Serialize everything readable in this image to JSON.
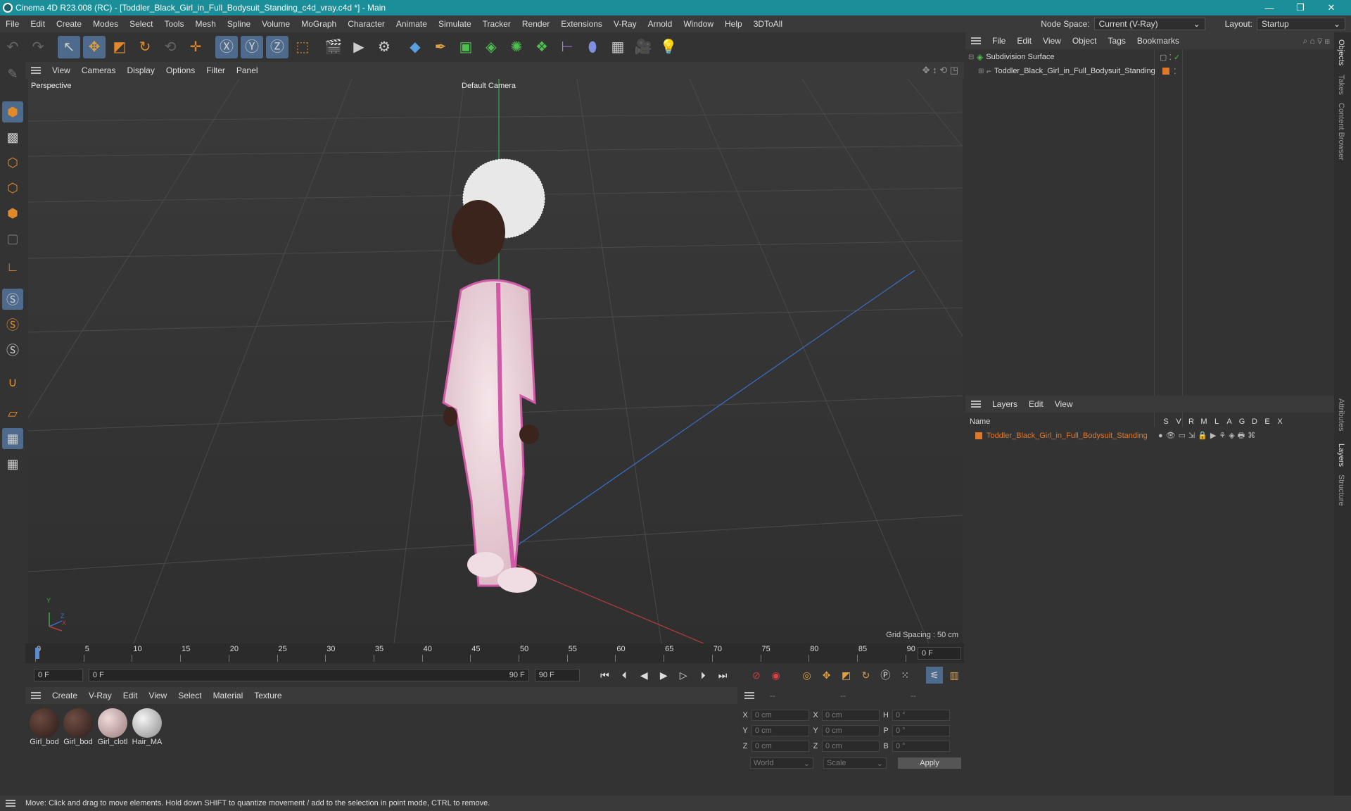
{
  "window": {
    "title": "Cinema 4D R23.008 (RC) - [Toddler_Black_Girl_in_Full_Bodysuit_Standing_c4d_vray.c4d *] - Main",
    "minimize": "—",
    "restore": "❐",
    "close": "✕"
  },
  "menubar": {
    "items": [
      "File",
      "Edit",
      "Create",
      "Modes",
      "Select",
      "Tools",
      "Mesh",
      "Spline",
      "Volume",
      "MoGraph",
      "Character",
      "Animate",
      "Simulate",
      "Tracker",
      "Render",
      "Extensions",
      "V-Ray",
      "Arnold",
      "Window",
      "Help",
      "3DToAll"
    ],
    "node_space_label": "Node Space:",
    "node_space_value": "Current (V-Ray)",
    "layout_label": "Layout:",
    "layout_value": "Startup"
  },
  "viewport": {
    "menu": [
      "View",
      "Cameras",
      "Display",
      "Options",
      "Filter",
      "Panel"
    ],
    "view_name": "Perspective",
    "camera": "Default Camera",
    "grid_spacing": "Grid Spacing : 50 cm",
    "axis_y": "Y",
    "axis_z": "Z",
    "axis_x": "X"
  },
  "timeline": {
    "ticks": [
      "0",
      "5",
      "10",
      "15",
      "20",
      "25",
      "30",
      "35",
      "40",
      "45",
      "50",
      "55",
      "60",
      "65",
      "70",
      "75",
      "80",
      "85",
      "90"
    ],
    "current_frame_right": "0 F",
    "start_field": "0 F",
    "range_start": "0 F",
    "range_end": "90 F",
    "end_field": "90 F"
  },
  "materials": {
    "menu": [
      "Create",
      "V-Ray",
      "Edit",
      "View",
      "Select",
      "Material",
      "Texture"
    ],
    "items": [
      {
        "label": "Girl_bod",
        "color": "#3a2622"
      },
      {
        "label": "Girl_bod",
        "color": "#3d2a26"
      },
      {
        "label": "Girl_clotl",
        "color": "#c9a9a9"
      },
      {
        "label": "Hair_MA",
        "color": "#cfcfcf"
      }
    ]
  },
  "coords": {
    "header": [
      "--",
      "--",
      "--"
    ],
    "rows": [
      {
        "a": "X",
        "av": "0 cm",
        "b": "X",
        "bv": "0 cm",
        "c": "H",
        "cv": "0 °"
      },
      {
        "a": "Y",
        "av": "0 cm",
        "b": "Y",
        "bv": "0 cm",
        "c": "P",
        "cv": "0 °"
      },
      {
        "a": "Z",
        "av": "0 cm",
        "b": "Z",
        "bv": "0 cm",
        "c": "B",
        "cv": "0 °"
      }
    ],
    "world": "World",
    "scale": "Scale",
    "apply": "Apply"
  },
  "objects": {
    "menu": [
      "File",
      "Edit",
      "View",
      "Object",
      "Tags",
      "Bookmarks"
    ],
    "tree": [
      {
        "name": "Subdivision Surface"
      },
      {
        "name": "Toddler_Black_Girl_in_Full_Bodysuit_Standing"
      }
    ]
  },
  "layers": {
    "menu": [
      "Layers",
      "Edit",
      "View"
    ],
    "header_name": "Name",
    "columns": [
      "S",
      "V",
      "R",
      "M",
      "L",
      "A",
      "G",
      "D",
      "E",
      "X"
    ],
    "rows": [
      {
        "name": "Toddler_Black_Girl_in_Full_Bodysuit_Standing"
      }
    ]
  },
  "side_tabs": [
    "Objects",
    "Takes",
    "Content Browser",
    "Attributes",
    "Layers",
    "Structure"
  ],
  "status": "Move: Click and drag to move elements. Hold down SHIFT to quantize movement / add to the selection in point mode, CTRL to remove.",
  "colors": {
    "titlebar": "#1a8e99",
    "accent_orange": "#e0782a",
    "selection_blue": "#4e6a8c"
  }
}
